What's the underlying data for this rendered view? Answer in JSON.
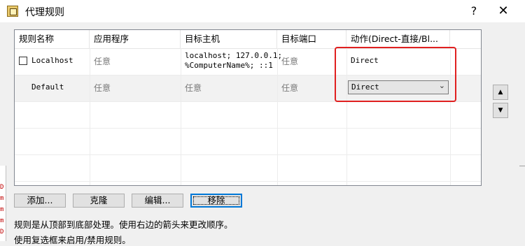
{
  "window": {
    "title": "代理规则",
    "help_symbol": "?",
    "close_symbol": "✕"
  },
  "table": {
    "headers": [
      "规则名称",
      "应用程序",
      "目标主机",
      "目标端口",
      "动作(Direct-直接/Bl..."
    ],
    "rows": [
      {
        "checked": false,
        "name": "Localhost",
        "app": "任意",
        "host_line1": "localhost; 127.0.0.1;",
        "host_line2": "%ComputerName%; ::1",
        "port": "任意",
        "action": "Direct"
      },
      {
        "name": "Default",
        "app": "任意",
        "host": "任意",
        "port": "任意",
        "action": "Direct"
      }
    ]
  },
  "buttons": {
    "add": "添加...",
    "clone": "克隆",
    "edit": "编辑...",
    "remove": "移除"
  },
  "info": {
    "line1": "规则是从顶部到底部处理。使用右边的箭头来更改顺序。",
    "line2": "使用复选框来启用/禁用规则。"
  },
  "background_window": {
    "fragments": [
      "D",
      "m",
      "m",
      "m",
      "D",
      "m"
    ]
  },
  "colors": {
    "highlight": "#e02020",
    "focus": "#0078d7"
  }
}
